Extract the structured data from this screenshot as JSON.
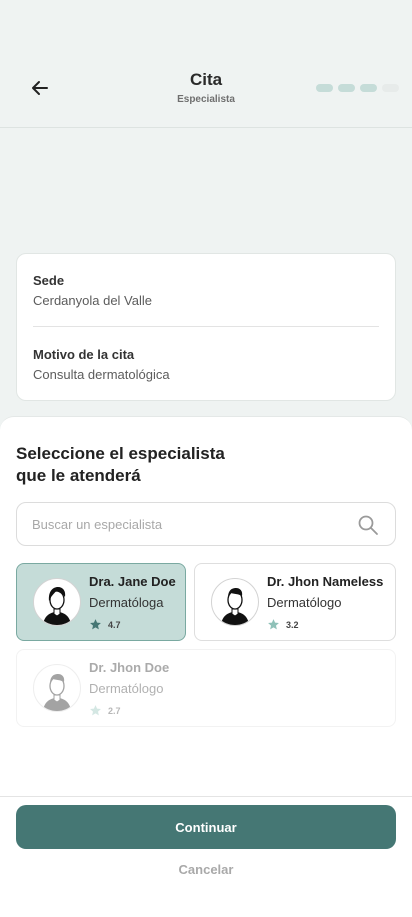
{
  "header": {
    "title": "Cita",
    "subtitle": "Especialista",
    "progress": {
      "done": 3,
      "total": 4
    }
  },
  "summary": {
    "site_label": "Sede",
    "site_value": "Cerdanyola del Valle",
    "reason_label": "Motivo de la cita",
    "reason_value": "Consulta dermatológica"
  },
  "selector": {
    "title_line1": "Seleccione el especialista",
    "title_line2": "que le atenderá",
    "search_placeholder": "Buscar un especialista",
    "doctors": [
      {
        "name": "Dra. Jane Doe",
        "specialty": "Dermatóloga",
        "rating": "4.7",
        "state": "selected"
      },
      {
        "name": "Dr. Jhon Nameless",
        "specialty": "Dermatólogo",
        "rating": "3.2",
        "state": "available"
      },
      {
        "name": "Dr. Jhon Doe",
        "specialty": "Dermatólogo",
        "rating": "2.7",
        "state": "disabled"
      }
    ]
  },
  "actions": {
    "continue_label": "Continuar",
    "cancel_label": "Cancelar"
  },
  "colors": {
    "primary": "#457774",
    "selected_bg": "#c5dcd8",
    "star_selected": "#457774",
    "star_default": "#8fc1b8"
  }
}
